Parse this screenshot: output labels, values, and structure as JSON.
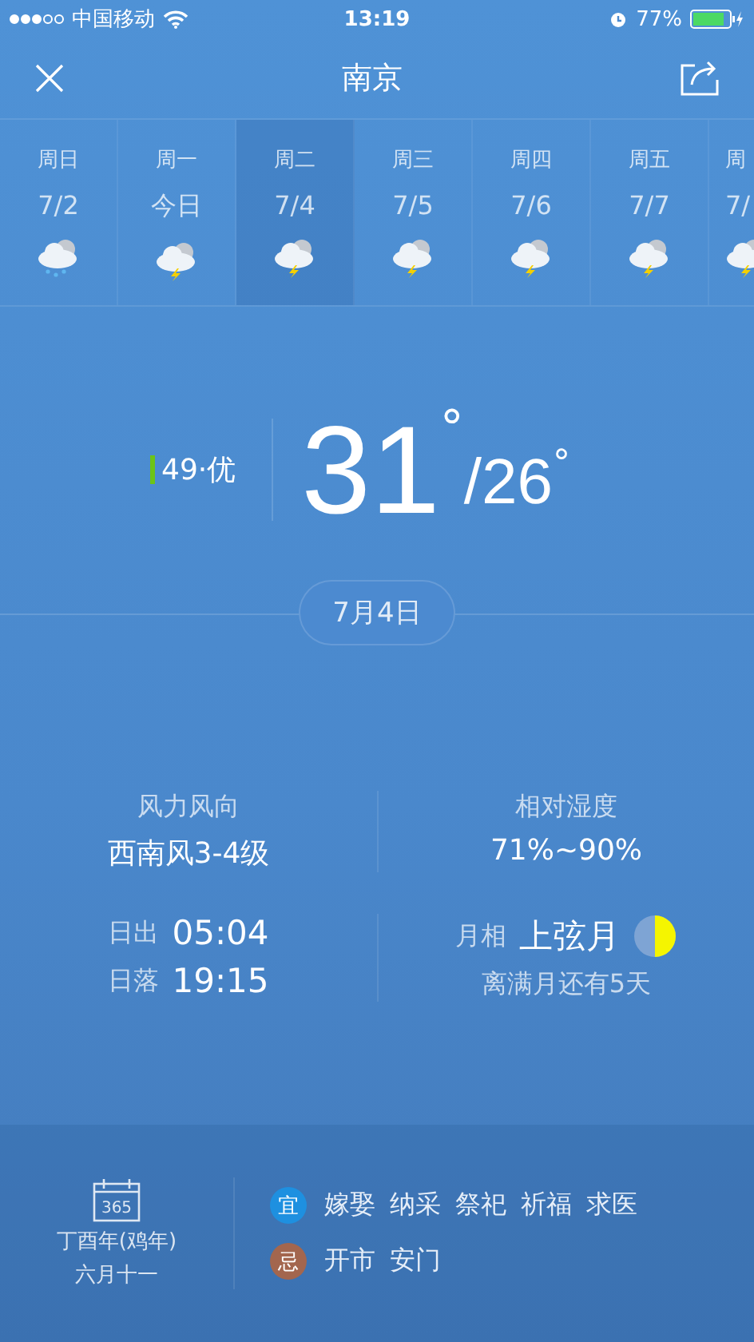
{
  "status_bar": {
    "carrier": "中国移动",
    "time": "13:19",
    "battery": "77%"
  },
  "header": {
    "title": "南京"
  },
  "days": [
    {
      "weekday": "周日",
      "date": "7/2",
      "kind": "rain",
      "selected": false
    },
    {
      "weekday": "周一",
      "date": "今日",
      "kind": "thunder",
      "selected": false
    },
    {
      "weekday": "周二",
      "date": "7/4",
      "kind": "thunder",
      "selected": true
    },
    {
      "weekday": "周三",
      "date": "7/5",
      "kind": "thunder",
      "selected": false
    },
    {
      "weekday": "周四",
      "date": "7/6",
      "kind": "thunder",
      "selected": false
    },
    {
      "weekday": "周五",
      "date": "7/7",
      "kind": "thunder",
      "selected": false
    },
    {
      "weekday": "周",
      "date": "7/",
      "kind": "thunder",
      "selected": false
    }
  ],
  "air_quality": {
    "text": "49·优",
    "color": "#6cc417"
  },
  "temperature": {
    "high": "31",
    "low": "/26",
    "degree": "°"
  },
  "date": "7月4日",
  "details": {
    "wind_label": "风力风向",
    "wind": "西南风3-4级",
    "humidity_label": "相对湿度",
    "humidity": "71%~90%",
    "sunrise_label": "日出",
    "sunrise": "05:04",
    "sunset_label": "日落",
    "sunset": "19:15",
    "moon_label": "月相",
    "moon": "上弦月",
    "moon_note": "离满月还有5天"
  },
  "almanac": {
    "icon_text": "365",
    "year": "丁酉年(鸡年)",
    "lunar_date": "六月十一",
    "rows": [
      {
        "tag": "宜",
        "color": "#1e90e0",
        "items": [
          "嫁娶",
          "纳采",
          "祭祀",
          "祈福",
          "求医"
        ]
      },
      {
        "tag": "忌",
        "color": "#a3664e",
        "items": [
          "开市",
          "安门"
        ]
      }
    ]
  }
}
